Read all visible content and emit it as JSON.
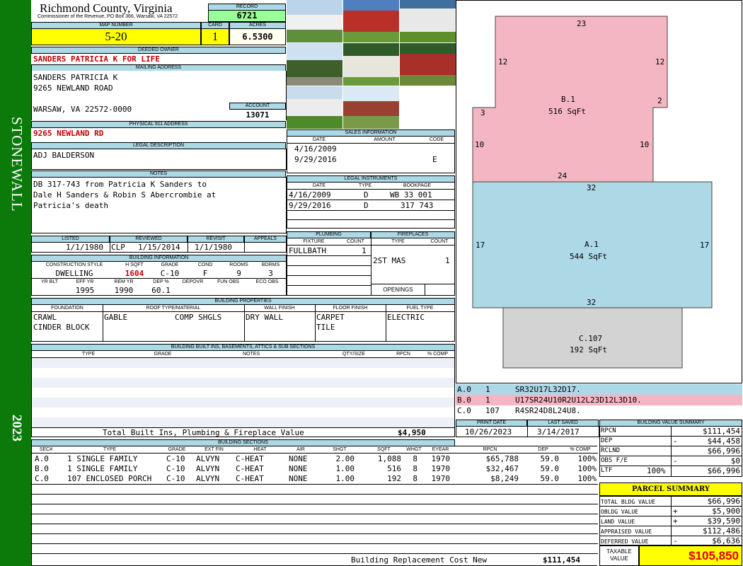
{
  "sidebar": {
    "district": "STONEWALL",
    "year": "2023"
  },
  "header": {
    "county": "Richmond County, Virginia",
    "commissioner": "Commissioner of the Revenue, PO Box 366, Warsaw, VA 22572",
    "record_label": "RECORD",
    "record": "6721",
    "map_number_label": "MAP NUMBER",
    "map_number": "5-20",
    "card_label": "CARD",
    "card": "1",
    "acres_label": "ACRES",
    "acres": "6.5300"
  },
  "owner": {
    "deeded_owner_label": "DEEDED OWNER",
    "deeded_owner": "SANDERS PATRICIA K FOR LIFE",
    "mailing_label": "MAILING ADDRESS",
    "mailing_lines": [
      "SANDERS PATRICIA K",
      "9265 NEWLAND ROAD",
      "",
      "WARSAW, VA 22572-0000"
    ],
    "account_label": "ACCOUNT",
    "account": "13071",
    "physical_label": "PHYSICAL 911 ADDRESS",
    "physical": "9265 NEWLAND RD"
  },
  "legal": {
    "label": "LEGAL DESCRIPTION",
    "text": "ADJ BALDERSON"
  },
  "notes": {
    "label": "NOTES",
    "lines": [
      "DB 317-743 from Patricia K Sanders to",
      "Dale H Sanders & Robin S Abercrombie at",
      "Patricia's death"
    ]
  },
  "dates": {
    "listed_label": "LISTED",
    "listed": "1/1/1980",
    "reviewed_label": "REVIEWED",
    "reviewed_by": "CLP",
    "reviewed": "1/15/2014",
    "revisit_label": "REVISIT",
    "revisit": "1/1/1980",
    "appeals_label": "APPEALS",
    "appeals": ""
  },
  "building_info": {
    "label": "BUILDING INFORMATION",
    "headers": [
      "CONSTRUCTION STYLE",
      "H SQFT",
      "GRADE",
      "COND",
      "ROOMS",
      "BDRMS"
    ],
    "values": [
      "DWELLING",
      "1604",
      "C-10",
      "F",
      "9",
      "3"
    ],
    "headers2": [
      "YR BLT",
      "EFF YR",
      "REM YR",
      "DEP %",
      "DEPOVR",
      "FUN OBS",
      "ECO OBS"
    ],
    "values2": [
      "",
      "1995",
      "1990",
      "60.1",
      "",
      "",
      ""
    ]
  },
  "sales": {
    "label": "SALES INFORMATION",
    "headers": [
      "DATE",
      "AMOUNT",
      "CODE"
    ],
    "rows": [
      [
        "4/16/2009",
        "",
        ""
      ],
      [
        "9/29/2016",
        "",
        "E"
      ]
    ]
  },
  "instruments": {
    "label": "LEGAL INSTRUMENTS",
    "headers": [
      "DATE",
      "TYPE",
      "BOOKPAGE"
    ],
    "rows": [
      [
        "4/16/2009",
        "D",
        "WB 33 001"
      ],
      [
        "9/29/2016",
        "D",
        "317 743"
      ]
    ]
  },
  "plumbing": {
    "label": "PLUMBING",
    "headers": [
      "FIXTURE",
      "COUNT"
    ],
    "rows": [
      [
        "FULLBATH",
        "1"
      ]
    ]
  },
  "fireplaces": {
    "label": "FIREPLACES",
    "headers": [
      "TYPE",
      "COUNT"
    ],
    "rows": [
      [
        "2ST MAS",
        "1"
      ]
    ],
    "openings_label": "OPENINGS",
    "openings": ""
  },
  "properties": {
    "label": "BUILDING PROPERTIES",
    "headers": [
      "FOUNDATION",
      "ROOF TYPE/MATERIAL",
      "WALL FINISH",
      "FLOOR FINISH",
      "FUEL TYPE"
    ],
    "foundation": [
      "CRAWL",
      "CINDER BLOCK"
    ],
    "roof_type": "GABLE",
    "roof_material": "COMP SHGLS",
    "wall": "DRY WALL",
    "floor": [
      "CARPET",
      "TILE"
    ],
    "fuel": "ELECTRIC"
  },
  "builtins": {
    "label": "BUILDING BUILT INS, BASEMENTS, ATTICS & SUB SECTIONS",
    "headers": [
      "TYPE",
      "GRADE",
      "NOTES",
      "QTY/SIZE",
      "RPCN",
      "% COMP"
    ],
    "total_label": "Total Built Ins, Plumbing & Fireplace Value",
    "total": "$4,950"
  },
  "sections": {
    "label": "BUILDING SECTIONS",
    "headers": [
      "SEC#",
      "TYPE",
      "GRADE",
      "EXT FIN",
      "HEAT",
      "AIR",
      "SHGT",
      "SQFT",
      "WHGT",
      "EYEAR",
      "RPCN",
      "DEP",
      "% COMP"
    ],
    "rows": [
      [
        "A.0",
        "1 SINGLE FAMILY",
        "C-10",
        "ALVYN",
        "C-HEAT",
        "NONE",
        "2.00",
        "1,088",
        "8",
        "1970",
        "$65,788",
        "59.0",
        "100%"
      ],
      [
        "B.0",
        "1 SINGLE FAMILY",
        "C-10",
        "ALVYN",
        "C-HEAT",
        "NONE",
        "1.00",
        "516",
        "8",
        "1970",
        "$32,467",
        "59.0",
        "100%"
      ],
      [
        "C.0",
        "107 ENCLOSED PORCH",
        "C-10",
        "ALVYN",
        "C-HEAT",
        "NONE",
        "1.00",
        "192",
        "8",
        "1970",
        "$8,249",
        "59.0",
        "100%"
      ]
    ],
    "replacement_label": "Building Replacement Cost New",
    "replacement": "$111,454"
  },
  "sketch": {
    "areas": [
      {
        "id": "B.1",
        "sqft": "516 SqFt",
        "color": "#f4b6c2",
        "dims": [
          "23",
          "12",
          "12",
          "2",
          "3",
          "10",
          "10",
          "24"
        ]
      },
      {
        "id": "A.1",
        "sqft": "544 SqFt",
        "color": "#add8e6",
        "dims": [
          "32",
          "17",
          "17",
          "32"
        ]
      },
      {
        "id": "C.107",
        "sqft": "192 SqFt",
        "color": "#d3d3d3",
        "dims": []
      }
    ],
    "legend": [
      {
        "sec": "A.0",
        "n": "1",
        "code": "SR32U17L32D17.",
        "color": "#add8e6"
      },
      {
        "sec": "B.0",
        "n": "1",
        "code": "U17SR24U10R2U12L23D12L3D10.",
        "color": "#f4b6c2"
      },
      {
        "sec": "C.0",
        "n": "107",
        "code": "R4SR24D8L24U8.",
        "color": "#ffffff"
      }
    ]
  },
  "print": {
    "print_label": "PRINT DATE",
    "print_date": "10/26/2023",
    "saved_label": "LAST SAVED",
    "last_saved": "3/14/2017"
  },
  "value_summary": {
    "label": "BUILDING VALUE SUMMARY",
    "rows": [
      {
        "k": "RPCN",
        "op": "",
        "v": "$111,454"
      },
      {
        "k": "DEP",
        "op": "-",
        "v": "$44,458"
      },
      {
        "k": "RCLND",
        "op": "",
        "v": "$66,996"
      },
      {
        "k": "OBS F/E",
        "op": "-",
        "v": "$0"
      },
      {
        "k": "LTF",
        "op": "100%",
        "v": "$66,996"
      }
    ]
  },
  "parcel": {
    "label": "PARCEL SUMMARY",
    "rows": [
      {
        "k": "TOTAL BLDG VALUE",
        "op": "",
        "v": "$66,996"
      },
      {
        "k": "OBLDG VALUE",
        "op": "+",
        "v": "$5,900"
      },
      {
        "k": "LAND VALUE",
        "op": "+",
        "v": "$39,590"
      },
      {
        "k": "APPRAISED VALUE",
        "op": "",
        "v": "$112,486"
      },
      {
        "k": "DEFERRED VALUE",
        "op": "-",
        "v": "$6,636"
      }
    ],
    "taxable_label_1": "TAXABLE",
    "taxable_label_2": "VALUE",
    "taxable": "$105,850"
  }
}
